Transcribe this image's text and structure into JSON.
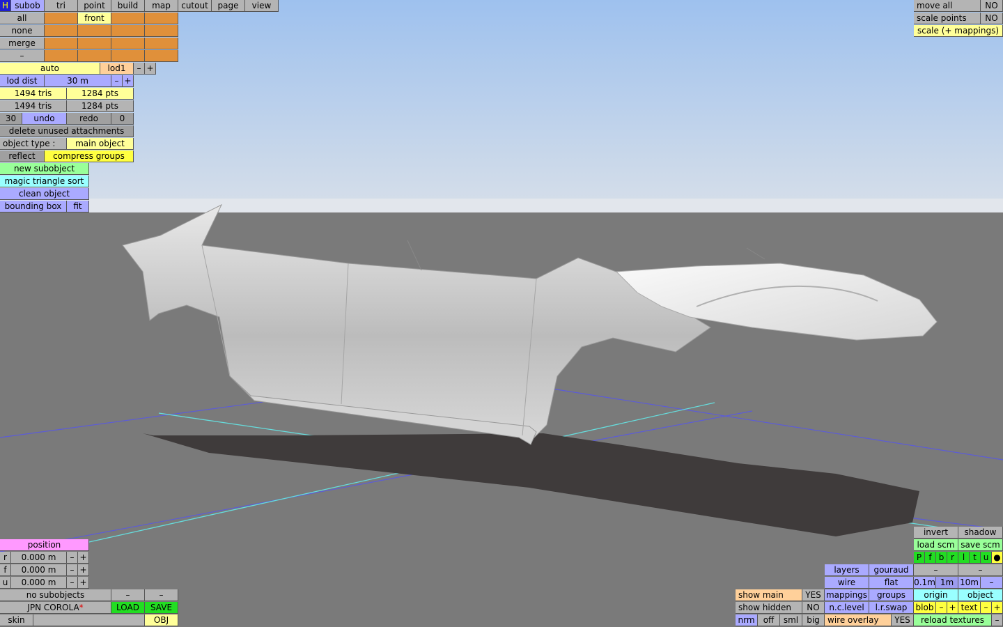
{
  "menu": {
    "h": "H",
    "tabs": [
      "subob",
      "tri",
      "point",
      "build",
      "map",
      "cutout",
      "page",
      "view"
    ],
    "active": "subob"
  },
  "subob_grid": {
    "rows": [
      "all",
      "none",
      "merge",
      "–"
    ],
    "col2_row1": "front"
  },
  "lod": {
    "mode": "auto",
    "level": "lod1",
    "minus": "–",
    "plus": "+"
  },
  "lod_dist": {
    "label": "lod dist",
    "value": "30 m",
    "minus": "–",
    "plus": "+"
  },
  "stats": {
    "row1": {
      "tris": "1494 tris",
      "pts": "1284 pts"
    },
    "row2": {
      "tris": "1494 tris",
      "pts": "1284 pts"
    }
  },
  "history": {
    "undo_count": "30",
    "undo": "undo",
    "redo": "redo",
    "redo_count": "0"
  },
  "actions": {
    "delete_unused": "delete unused attachments",
    "object_type_label": "object type :",
    "object_type_value": "main object",
    "reflect": "reflect",
    "compress_groups": "compress groups",
    "new_subobject": "new subobject",
    "magic_sort": "magic triangle sort",
    "clean_object": "clean object",
    "bounding_box": "bounding box",
    "fit": "fit"
  },
  "top_right": {
    "move_all": "move all",
    "move_all_val": "NO",
    "scale_points": "scale points",
    "scale_points_val": "NO",
    "scale_mappings": "scale (+ mappings)"
  },
  "position": {
    "title": "position",
    "rows": [
      {
        "axis": "r",
        "value": "0.000 m"
      },
      {
        "axis": "f",
        "value": "0.000 m"
      },
      {
        "axis": "u",
        "value": "0.000 m"
      }
    ],
    "minus": "–",
    "plus": "+"
  },
  "bottom_left": {
    "no_subobjects": "no subobjects",
    "dash": "–",
    "name": "JPN COROLA",
    "modified_mark": "*",
    "load": "LOAD",
    "save": "SAVE",
    "skin": "skin",
    "obj": "OBJ"
  },
  "bottom_right": {
    "invert": "invert",
    "shadow": "shadow",
    "load_scm": "load scm",
    "save_scm": "save scm",
    "views": [
      "P",
      "f",
      "b",
      "r",
      "l",
      "t",
      "u"
    ],
    "dot": "●",
    "dash": "–",
    "layers": "layers",
    "gouraud": "gouraud",
    "wire": "wire",
    "flat": "flat",
    "step1": "0.1m",
    "step2": "1m",
    "step3": "10m",
    "show_main": "show main",
    "show_main_val": "YES",
    "mappings": "mappings",
    "groups": "groups",
    "origin": "origin",
    "object": "object",
    "show_hidden": "show hidden",
    "show_hidden_val": "NO",
    "nc_level": "n.c.level",
    "lr_swap": "l.r.swap",
    "blob": "blob",
    "text": "text",
    "nrm": "nrm",
    "off": "off",
    "sml": "sml",
    "big": "big",
    "wire_overlay": "wire overlay",
    "wire_overlay_val": "YES",
    "reload_textures": "reload textures"
  }
}
